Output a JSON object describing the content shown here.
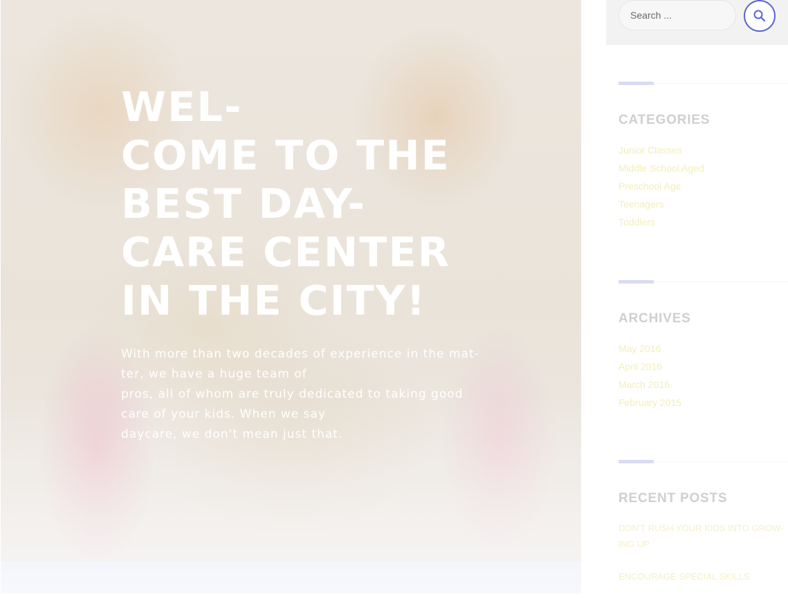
{
  "hero": {
    "title_lines": [
      "WEL-",
      "COME TO THE",
      "BEST DAY-",
      "CARE CENTER",
      "IN THE CITY!"
    ],
    "description_lines": [
      "With more than two decades of experience in the mat-",
      "ter, we have a huge team of",
      "pros, all of whom are truly dedicated to taking good",
      "care of your kids. When we say",
      "daycare, we don't mean just that."
    ]
  },
  "search": {
    "placeholder": "Search ...",
    "icon": "search-icon",
    "accent_color": "#5b64cf"
  },
  "categories": {
    "title": "CATEGORIES",
    "items": [
      "Junior Classes",
      "Middle School Aged",
      "Preschool Age",
      "Teenagers",
      "Toddlers"
    ]
  },
  "archives": {
    "title": "ARCHIVES",
    "items": [
      "May 2016",
      "April 2016",
      "March 2016",
      "February 2015"
    ]
  },
  "recent_posts": {
    "title": "RECENT POSTS",
    "items": [
      [
        "DON'T RUSH YOUR KIDS INTO GROW-",
        "ING UP"
      ],
      [
        "ENCOURAGE SPECIAL SKILLS"
      ]
    ]
  }
}
